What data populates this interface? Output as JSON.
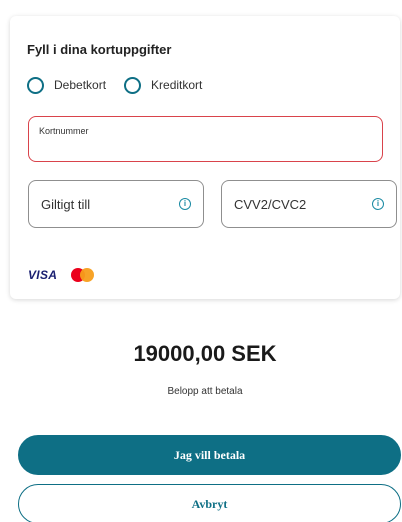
{
  "card_form": {
    "title": "Fyll i dina kortuppgifter",
    "card_types": [
      {
        "label": "Debetkort",
        "selected": false
      },
      {
        "label": "Kreditkort",
        "selected": false
      }
    ],
    "card_number_label": "Kortnummer",
    "expiry_placeholder": "Giltigt till",
    "cvv_placeholder": "CVV2/CVC2",
    "info_icon_glyph": "i",
    "brands": {
      "visa_label": "VISA",
      "mastercard_icon": "mastercard-logo"
    }
  },
  "payment": {
    "amount": "19000,00 SEK",
    "amount_caption": "Belopp att betala"
  },
  "actions": {
    "pay_label": "Jag vill betala",
    "cancel_label": "Avbryt"
  },
  "colors": {
    "accent": "#0e6f85",
    "error_border": "#d9434b",
    "visa": "#1a1f71",
    "mastercard_red": "#eb001b",
    "mastercard_yellow": "#f79e1b"
  }
}
